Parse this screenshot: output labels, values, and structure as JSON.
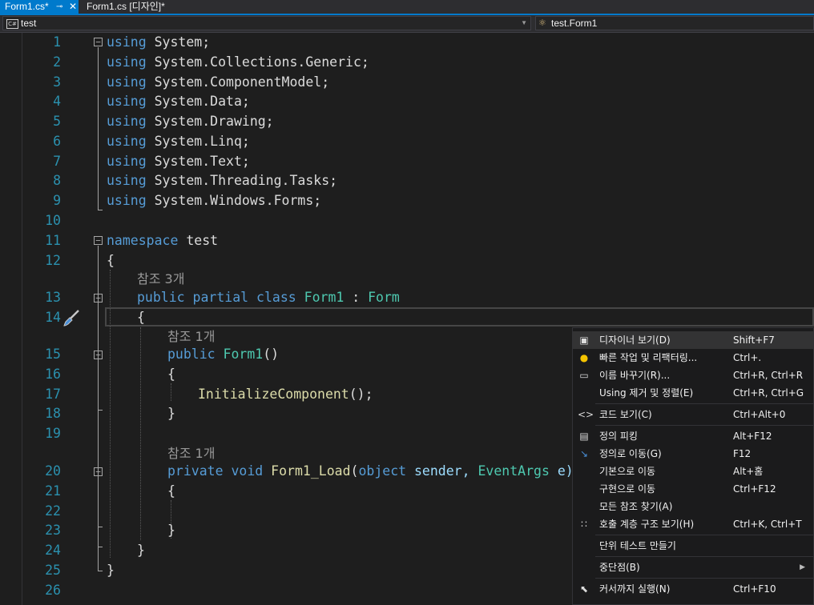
{
  "tabs": {
    "active": "Form1.cs*",
    "pin": "⊸",
    "close": "✕",
    "inactive": "Form1.cs [디자인]*"
  },
  "navbar": {
    "project": "test",
    "project_icon": "C#",
    "type": "test.Form1"
  },
  "lines": [
    {
      "n": "1"
    },
    {
      "n": "2"
    },
    {
      "n": "3"
    },
    {
      "n": "4"
    },
    {
      "n": "5"
    },
    {
      "n": "6"
    },
    {
      "n": "7"
    },
    {
      "n": "8"
    },
    {
      "n": "9"
    },
    {
      "n": "10"
    },
    {
      "n": "11"
    },
    {
      "n": "12"
    },
    {
      "n": "13"
    },
    {
      "n": "14"
    },
    {
      "n": "15"
    },
    {
      "n": "16"
    },
    {
      "n": "17"
    },
    {
      "n": "18"
    },
    {
      "n": "19"
    },
    {
      "n": "20"
    },
    {
      "n": "21"
    },
    {
      "n": "22"
    },
    {
      "n": "23"
    },
    {
      "n": "24"
    },
    {
      "n": "25"
    },
    {
      "n": "26"
    }
  ],
  "code": {
    "using": "using",
    "u1": "System;",
    "u2": "System.Collections.Generic;",
    "u3": "System.ComponentModel;",
    "u4": "System.Data;",
    "u5": "System.Drawing;",
    "u6": "System.Linq;",
    "u7": "System.Text;",
    "u8": "System.Threading.Tasks;",
    "u9": "System.Windows.Forms;",
    "namespace_kw": "namespace",
    "namespace_name": "test",
    "open_brace": "{",
    "close_brace": "}",
    "public_kw": "public",
    "partial_kw": "partial",
    "class_kw": "class",
    "class_name": "Form1",
    "colon": ":",
    "base_class": "Form",
    "ctor_name": "Form1",
    "ctor_parens": "()",
    "init_call": "InitializeComponent",
    "init_tail": "();",
    "private_kw": "private",
    "void_kw": "void",
    "method_name": "Form1_Load",
    "paren_open": "(",
    "object_kw": "object",
    "sender": "sender,",
    "event_type": "EventArgs",
    "e": "e)",
    "ref3": "참조 3개",
    "ref1": "참조 1개"
  },
  "menu": {
    "items": [
      {
        "label": "디자이너 보기(D)",
        "shortcut": "Shift+F7",
        "icon": "designer-icon"
      },
      {
        "label": "빠른 작업 및 리팩터링...",
        "shortcut": "Ctrl+.",
        "icon": "lightbulb-icon"
      },
      {
        "label": "이름 바꾸기(R)...",
        "shortcut": "Ctrl+R, Ctrl+R",
        "icon": "rename-icon"
      },
      {
        "label": "Using 제거 및 정렬(E)",
        "shortcut": "Ctrl+R, Ctrl+G",
        "icon": ""
      },
      {
        "label": "코드 보기(C)",
        "shortcut": "Ctrl+Alt+0",
        "icon": "code-icon"
      },
      {
        "label": "정의 피킹",
        "shortcut": "Alt+F12",
        "icon": "peek-icon"
      },
      {
        "label": "정의로 이동(G)",
        "shortcut": "F12",
        "icon": "goto-definition-icon"
      },
      {
        "label": "기본으로 이동",
        "shortcut": "Alt+홈",
        "icon": ""
      },
      {
        "label": "구현으로 이동",
        "shortcut": "Ctrl+F12",
        "icon": ""
      },
      {
        "label": "모든 참조 찾기(A)",
        "shortcut": "",
        "icon": ""
      },
      {
        "label": "호출 계층 구조 보기(H)",
        "shortcut": "Ctrl+K, Ctrl+T",
        "icon": "call-hierarchy-icon"
      },
      {
        "label": "단위 테스트 만들기",
        "shortcut": "",
        "icon": ""
      },
      {
        "label": "중단점(B)",
        "shortcut": "",
        "icon": "",
        "submenu": "▶"
      },
      {
        "label": "커서까지 실행(N)",
        "shortcut": "Ctrl+F10",
        "icon": "run-to-cursor-icon"
      }
    ]
  }
}
